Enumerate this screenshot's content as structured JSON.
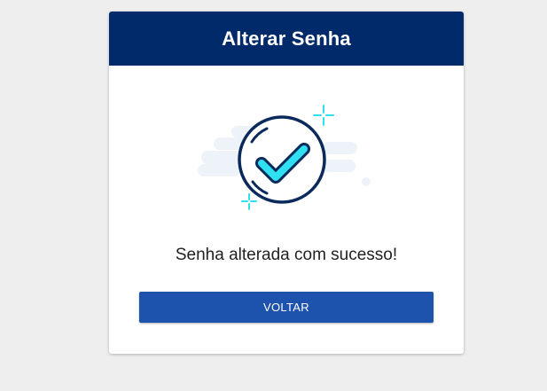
{
  "card": {
    "title": "Alterar Senha",
    "message": "Senha alterada com sucesso!",
    "back_button_label": "VOLTAR"
  },
  "illustration": {
    "icon": "success-checkmark-icon",
    "sparkle_icon": "sparkle-icon",
    "cloud_icon": "cloud-icon"
  },
  "colors": {
    "header_background": "#002a6a",
    "button_background": "#1d53ad",
    "check_fill": "#2ee0f0",
    "outline": "#0b2a5c",
    "page_background": "#eeeeee"
  }
}
